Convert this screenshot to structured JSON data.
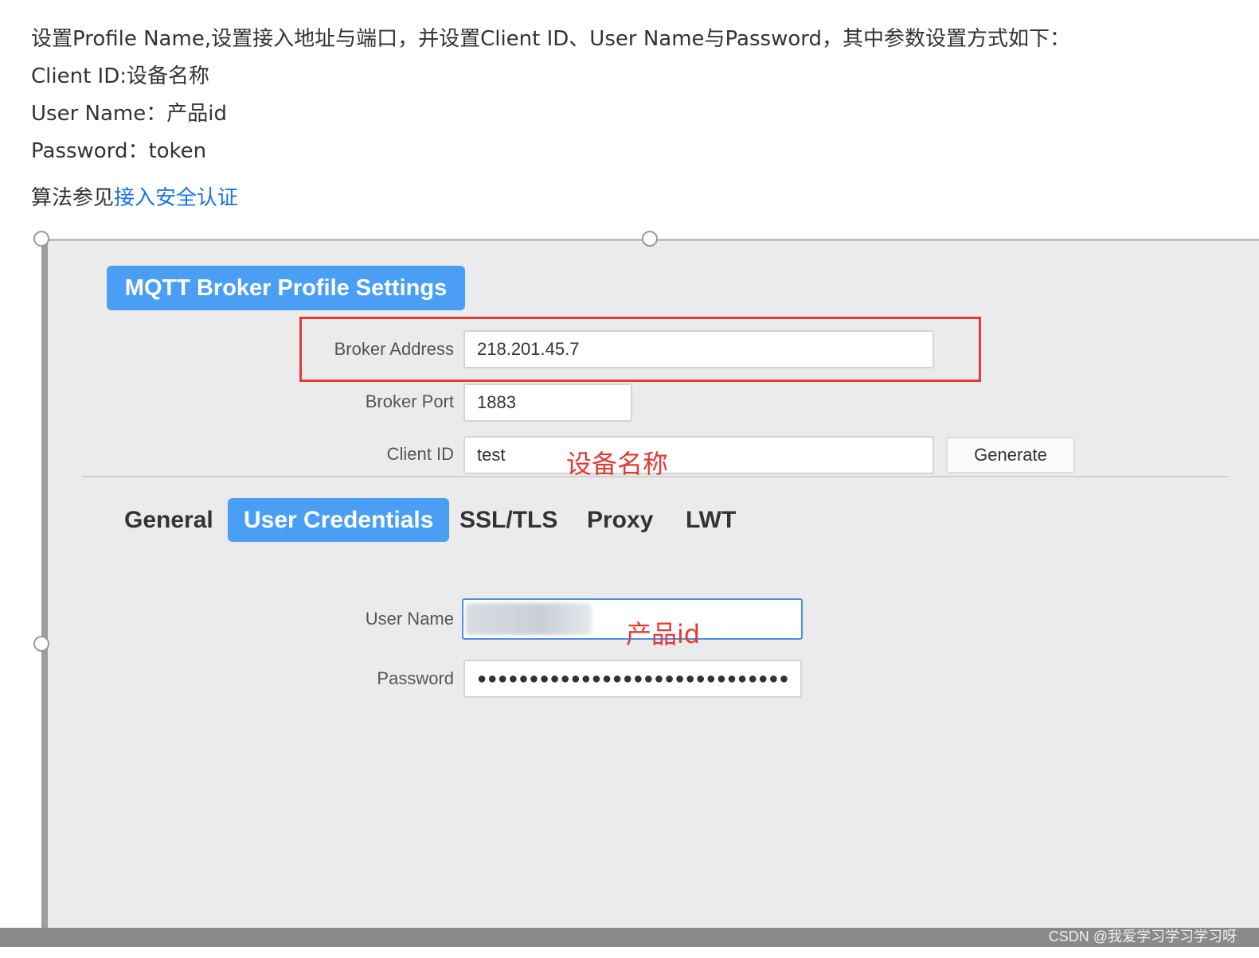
{
  "intro": {
    "line1": "设置Profile Name,设置接入地址与端口，并设置Client ID、User Name与Password，其中参数设置方式如下：",
    "line2": "Client ID:设备名称",
    "line3": "User Name：产品id",
    "line4": "Password：token",
    "algo_prefix": "算法参见",
    "algo_link": "接入安全认证"
  },
  "panel": {
    "title": "MQTT Broker Profile Settings",
    "broker_address_label": "Broker Address",
    "broker_address_value": "218.201.45.7",
    "broker_port_label": "Broker Port",
    "broker_port_value": "1883",
    "client_id_label": "Client ID",
    "client_id_value": "test",
    "client_id_annotation": "设备名称",
    "generate_label": "Generate",
    "tabs": [
      "General",
      "User Credentials",
      "SSL/TLS",
      "Proxy",
      "LWT"
    ],
    "active_tab": "User Credentials",
    "user_name_label": "User Name",
    "user_name_annotation": "产品id",
    "password_label": "Password",
    "password_value": "●●●●●●●●●●●●●●●●●●●●●●●●●●●●●●"
  },
  "watermark": "CSDN @我爱学习学习学习呀",
  "colors": {
    "accent": "#4a9ff5",
    "annotation": "#e53935",
    "link": "#1a73e8",
    "panel_bg": "#ebebeb"
  }
}
